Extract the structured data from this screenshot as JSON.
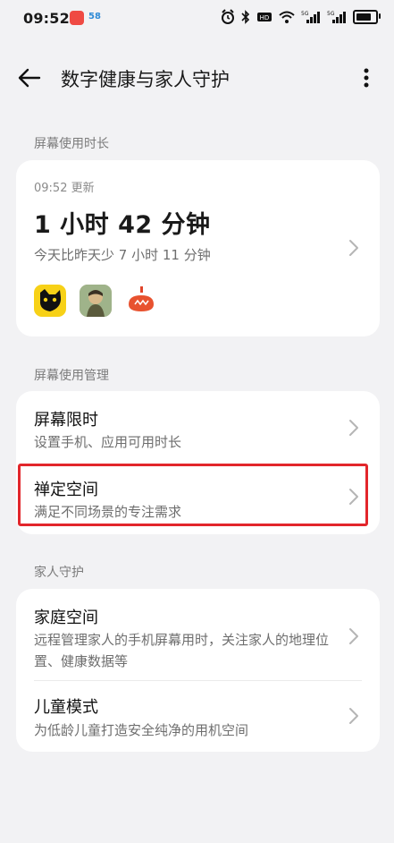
{
  "status_bar": {
    "time": "09:52",
    "badge2_text": "58"
  },
  "header": {
    "title": "数字健康与家人守护"
  },
  "screen_time": {
    "section_label": "屏幕使用时长",
    "updated": "09:52 更新",
    "total": "1 小时 42 分钟",
    "compare": "今天比昨天少 7 小时 11 分钟",
    "apps": [
      "cat-app-icon",
      "game-app-icon",
      "tomato-app-icon"
    ]
  },
  "management": {
    "section_label": "屏幕使用管理",
    "items": [
      {
        "title": "屏幕限时",
        "subtitle": "设置手机、应用可用时长"
      },
      {
        "title": "禅定空间",
        "subtitle": "满足不同场景的专注需求"
      }
    ]
  },
  "family": {
    "section_label": "家人守护",
    "items": [
      {
        "title": "家庭空间",
        "subtitle": "远程管理家人的手机屏幕用时，关注家人的地理位置、健康数据等"
      },
      {
        "title": "儿童模式",
        "subtitle": "为低龄儿童打造安全纯净的用机空间"
      }
    ]
  },
  "colors": {
    "background": "#f2f2f4",
    "card": "#ffffff",
    "highlight": "#e2262b"
  }
}
